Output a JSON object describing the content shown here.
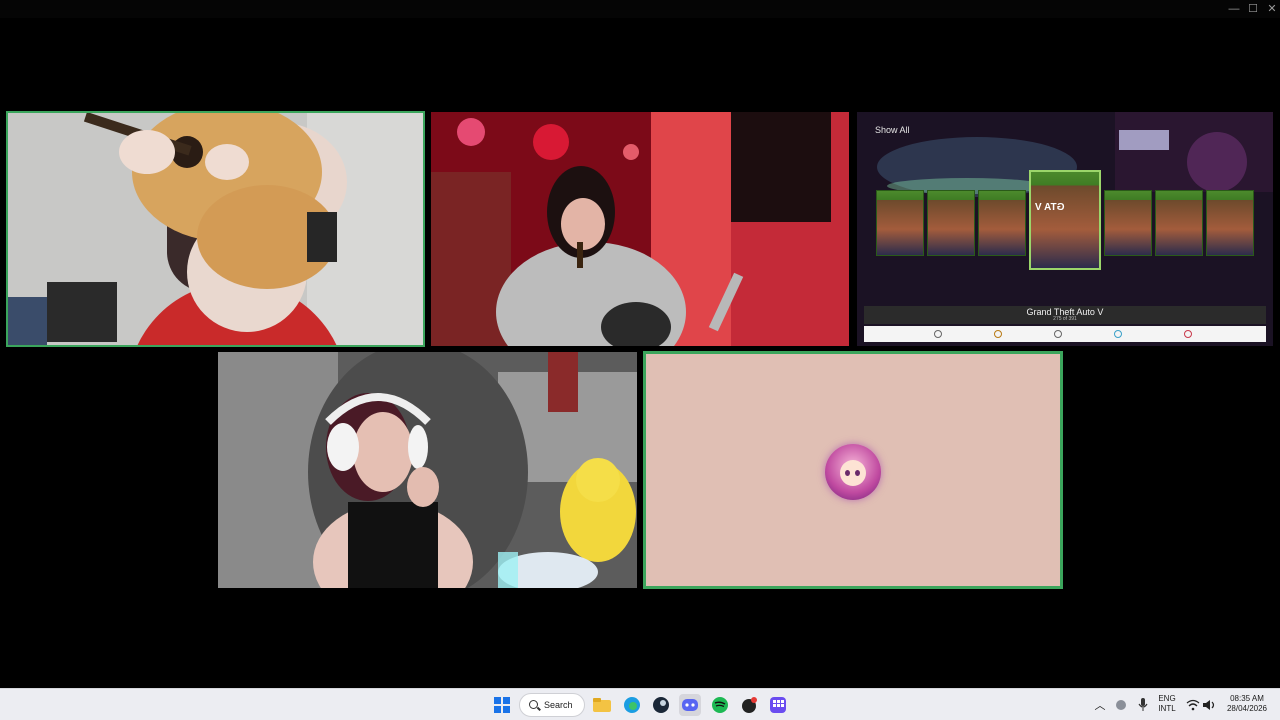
{
  "window": {
    "controls": {
      "minimize": "—",
      "maximize": "☐",
      "close": "✕"
    }
  },
  "tiles": [
    {
      "name": "participant-tile-guitar",
      "speaking": true
    },
    {
      "name": "participant-tile-red-room",
      "speaking": false
    },
    {
      "name": "participant-tile-screen-share",
      "speaking": false
    },
    {
      "name": "participant-tile-streamer",
      "speaking": false
    },
    {
      "name": "participant-tile-avatar",
      "speaking": true
    }
  ],
  "game": {
    "show_all": "Show All",
    "title": "Grand Theft Auto V",
    "count": "275 of 391",
    "cover_text": "GTA V"
  },
  "taskbar": {
    "search_label": "Search",
    "language": "ENG",
    "layout": "INTL",
    "time": "08:35 AM",
    "date": "28/04/2026"
  },
  "colors": {
    "speaking_outline": "#3ba55c",
    "avatar_tile_bg": "#e0bfb4",
    "taskbar_bg": "#ecedf2"
  }
}
